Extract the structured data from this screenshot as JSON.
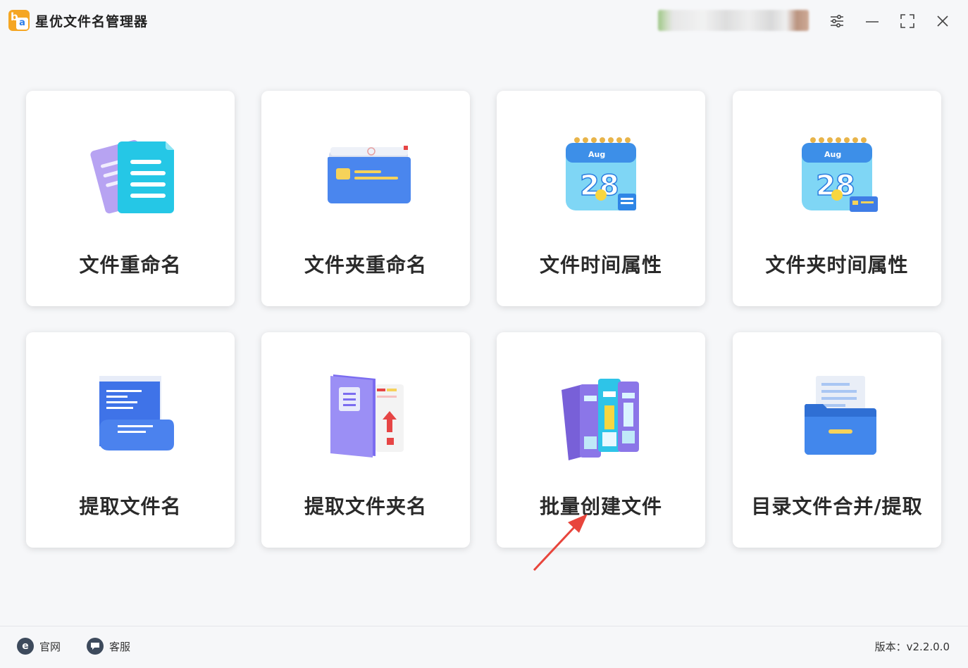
{
  "app": {
    "title": "星优文件名管理器",
    "logo_letters": [
      "b",
      "a"
    ]
  },
  "window_controls": [
    "settings-sliders-icon",
    "minimize-icon",
    "maximize-icon",
    "close-icon"
  ],
  "cards": [
    {
      "label": "文件重命名",
      "icon": "documents-icon"
    },
    {
      "label": "文件夹重命名",
      "icon": "folder-icon"
    },
    {
      "label": "文件时间属性",
      "icon": "calendar-file-icon"
    },
    {
      "label": "文件夹时间属性",
      "icon": "calendar-folder-icon"
    },
    {
      "label": "提取文件名",
      "icon": "scroll-document-icon"
    },
    {
      "label": "提取文件夹名",
      "icon": "folder-upload-icon"
    },
    {
      "label": "批量创建文件",
      "icon": "binders-icon"
    },
    {
      "label": "目录文件合并/提取",
      "icon": "file-drawer-icon"
    }
  ],
  "footer": {
    "website_label": "官网",
    "support_label": "客服",
    "version_text": "版本：v2.2.0.0"
  },
  "colors": {
    "accent_blue": "#3b8cf5",
    "cyan": "#27c6e8",
    "purple": "#7a6cf0",
    "arrow_red": "#e8453c"
  }
}
